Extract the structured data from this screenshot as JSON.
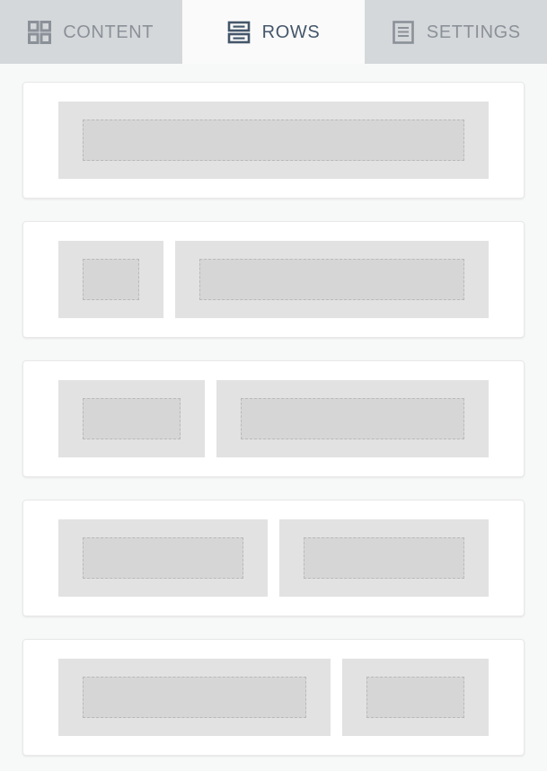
{
  "tabs": [
    {
      "id": "content",
      "label": "CONTENT",
      "icon": "grid-icon",
      "active": false
    },
    {
      "id": "rows",
      "label": "ROWS",
      "icon": "rows-icon",
      "active": true
    },
    {
      "id": "settings",
      "label": "SETTINGS",
      "icon": "document-icon",
      "active": false
    }
  ],
  "colors": {
    "tabbar_bg": "#d5d8da",
    "tab_active_bg": "#fafafa",
    "tab_inactive_text": "#8b9199",
    "tab_active_text": "#44566a",
    "page_bg": "#f7f8f8",
    "card_bg": "#ffffff",
    "card_border": "#e8e8e8",
    "column_bg": "#e2e2e2",
    "placeholder_bg": "#d6d6d6",
    "placeholder_border": "#b9b9b9"
  },
  "rows": [
    {
      "name": "row-layout-1-column",
      "columns": [
        {
          "ratio": 100
        }
      ]
    },
    {
      "name": "row-layout-33-67",
      "columns": [
        {
          "ratio": 25
        },
        {
          "ratio": 75
        }
      ]
    },
    {
      "name": "row-layout-33-67-alt",
      "columns": [
        {
          "ratio": 35
        },
        {
          "ratio": 65
        }
      ]
    },
    {
      "name": "row-layout-50-50",
      "columns": [
        {
          "ratio": 50
        },
        {
          "ratio": 50
        }
      ]
    },
    {
      "name": "row-layout-67-33",
      "columns": [
        {
          "ratio": 65
        },
        {
          "ratio": 35
        }
      ]
    }
  ]
}
